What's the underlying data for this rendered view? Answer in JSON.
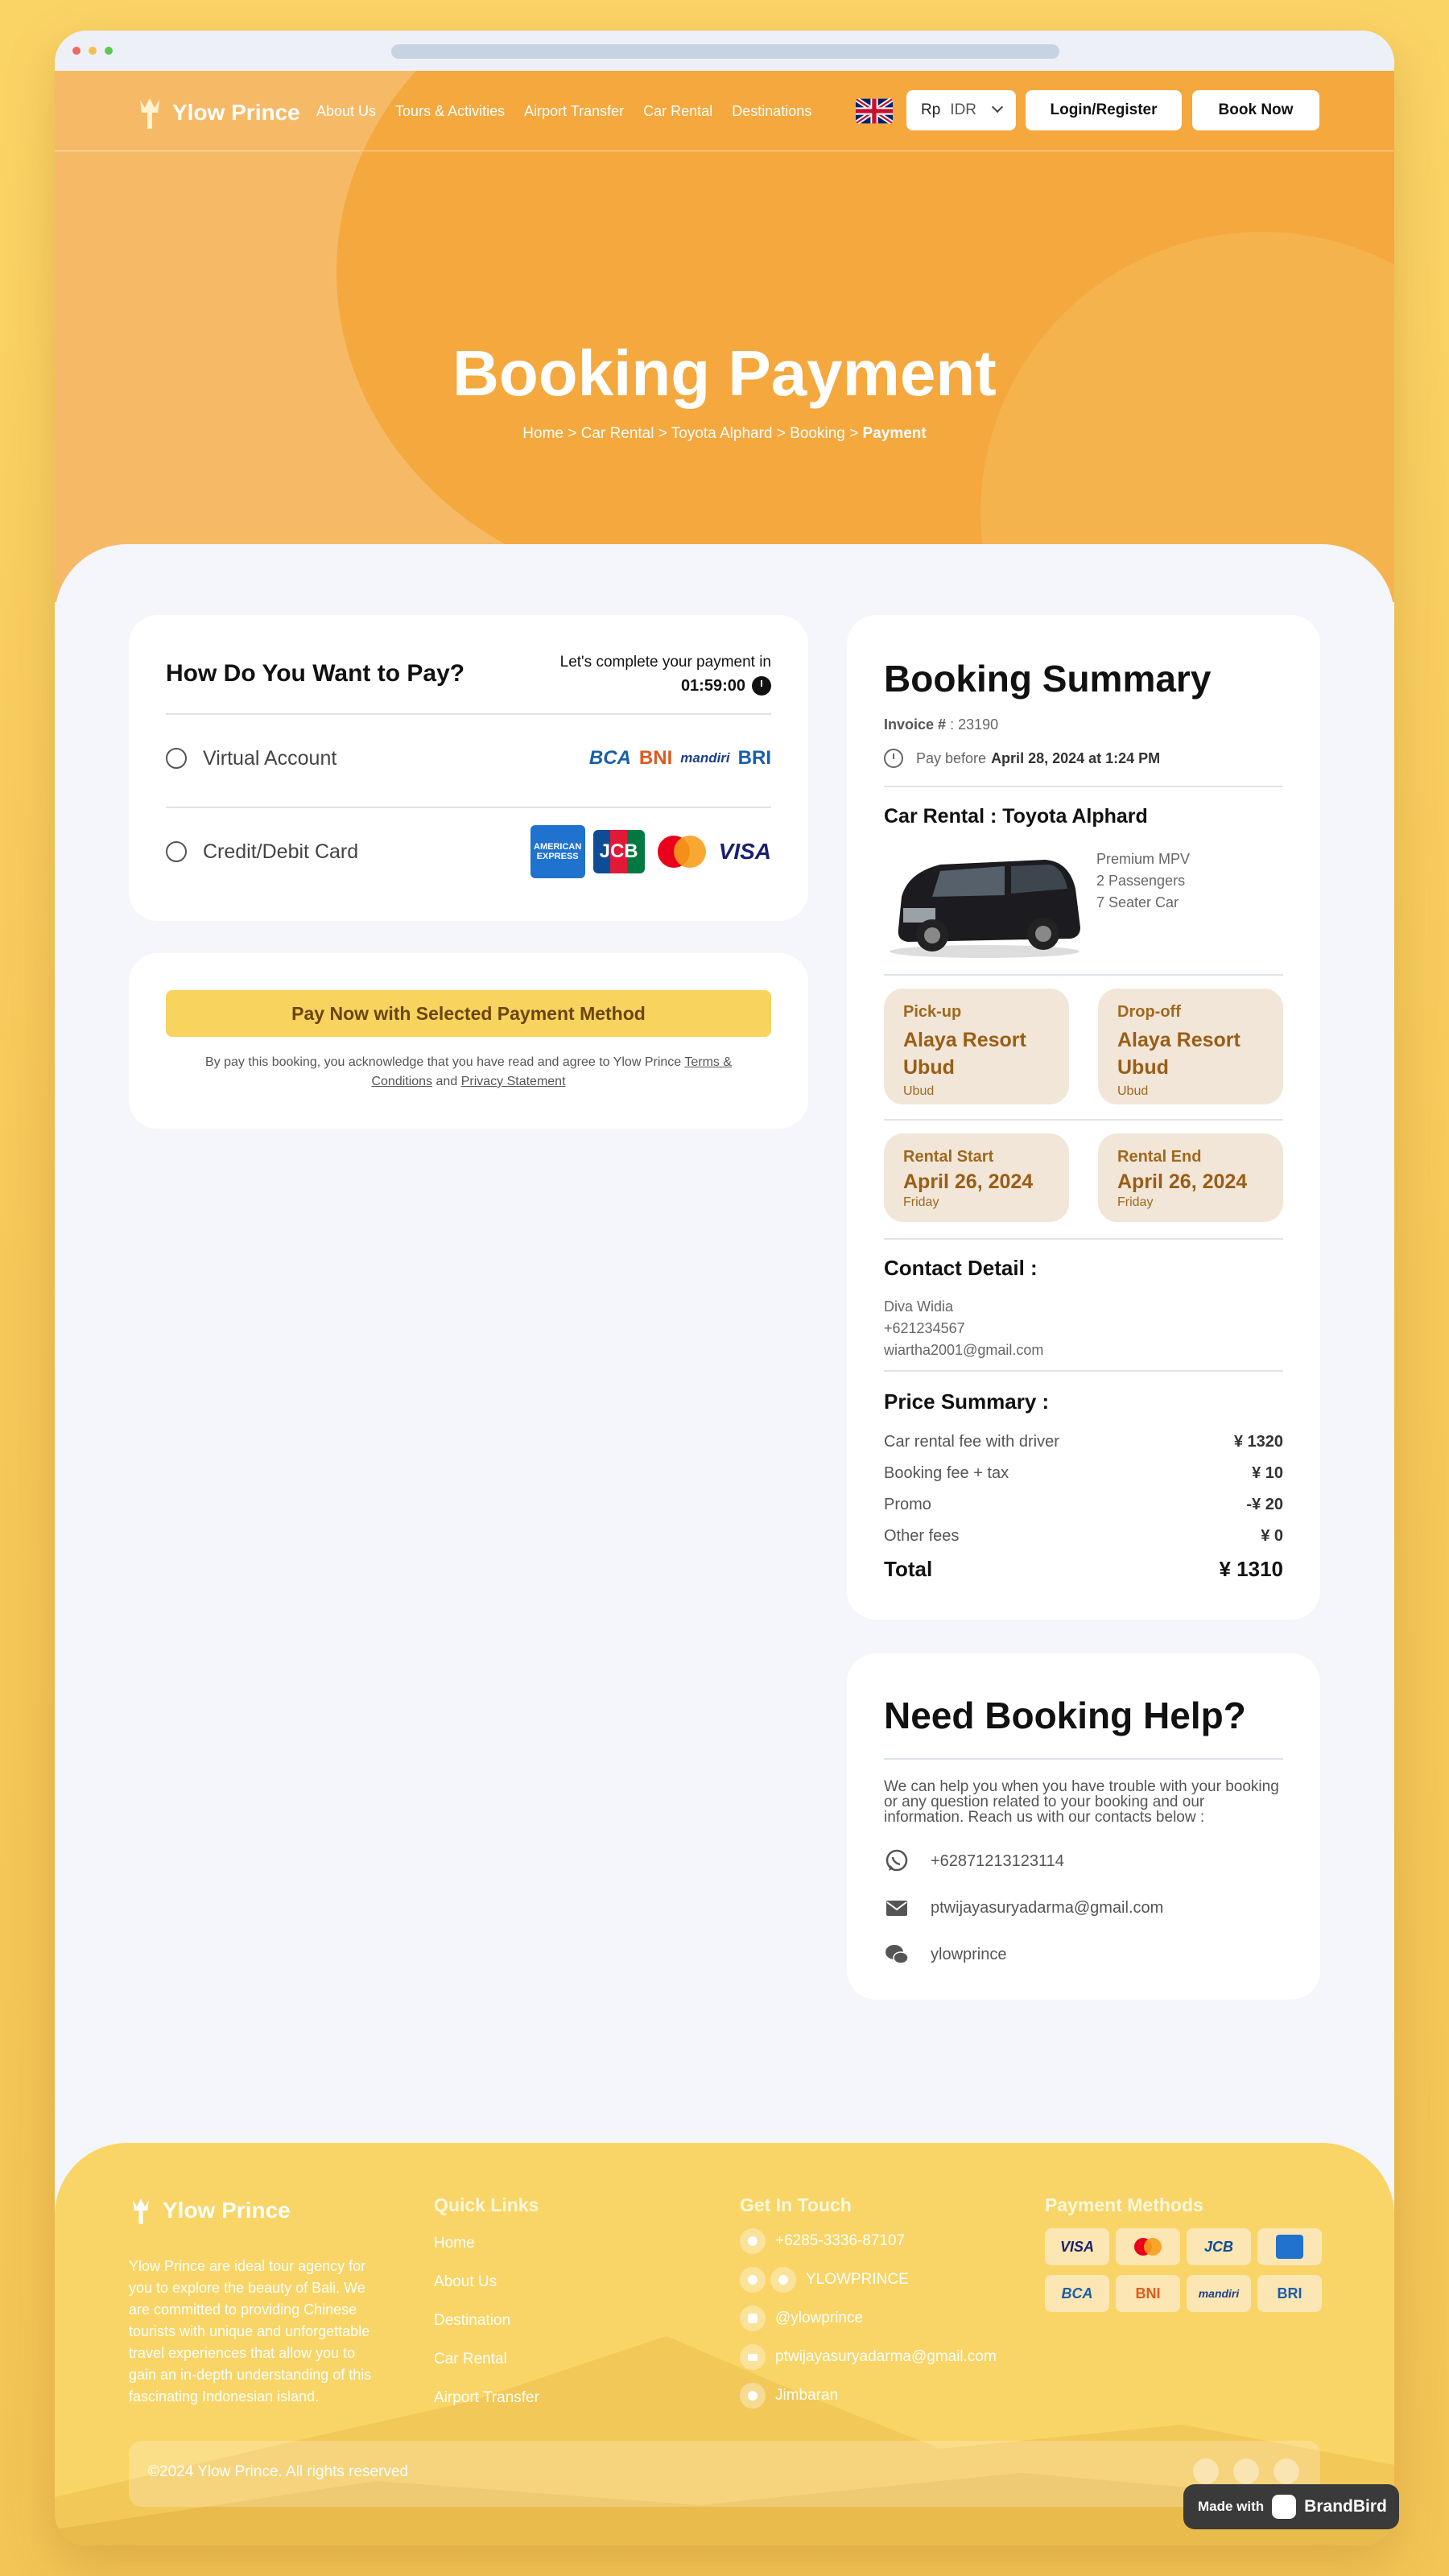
{
  "header": {
    "brand": "Ylow Prince",
    "nav": [
      "About Us",
      "Tours & Activities",
      "Airport Transfer",
      "Car Rental",
      "Destinations"
    ],
    "currency_symbol": "Rp",
    "currency_code": "IDR",
    "login_label": "Login/Register",
    "book_label": "Book Now"
  },
  "hero": {
    "title": "Booking Payment",
    "breadcrumbs": [
      "Home",
      "Car Rental",
      "Toyota Alphard",
      "Booking"
    ],
    "breadcrumb_current": "Payment",
    "separator": ">"
  },
  "payment": {
    "title": "How Do You Want to Pay?",
    "complete_text": "Let's complete your payment in",
    "timer": "01:59:00",
    "options": [
      {
        "label": "Virtual Account",
        "logos": [
          "BCA",
          "BNI",
          "mandiri",
          "BRI"
        ]
      },
      {
        "label": "Credit/Debit Card",
        "logos": [
          "AMERICAN EXPRESS",
          "JCB",
          "mastercard",
          "VISA"
        ]
      }
    ],
    "pay_button": "Pay Now with Selected Payment Method",
    "agree_pre": "By pay this booking, you acknowledge that you have read and agree to Ylow Prince",
    "terms": "Terms & Conditions",
    "and": "and",
    "privacy": "Privacy Statement"
  },
  "summary": {
    "title": "Booking Summary",
    "invoice_label": "Invoice #",
    "invoice_value": ": 23190",
    "pay_before_label": "Pay before",
    "pay_before_value": "April 28, 2024 at 1:24 PM",
    "car_title": "Car Rental : Toyota Alphard",
    "car_specs": [
      "Premium MPV",
      "2 Passengers",
      "7 Seater Car"
    ],
    "pickup": {
      "label": "Pick-up",
      "value": "Alaya Resort Ubud",
      "sub": "Ubud"
    },
    "dropoff": {
      "label": "Drop-off",
      "value": "Alaya Resort Ubud",
      "sub": "Ubud"
    },
    "rental_start": {
      "label": "Rental Start",
      "value": "April 26, 2024",
      "sub": "Friday"
    },
    "rental_end": {
      "label": "Rental End",
      "value": "April 26, 2024",
      "sub": "Friday"
    },
    "contact_title": "Contact Detail :",
    "contact": [
      "Diva Widia",
      "+621234567",
      "wiartha2001@gmail.com"
    ],
    "price_title": "Price Summary :",
    "prices": [
      {
        "label": "Car rental fee with driver",
        "amount": "¥ 1320"
      },
      {
        "label": "Booking fee + tax",
        "amount": "¥ 10"
      },
      {
        "label": "Promo",
        "amount": "-¥ 20"
      },
      {
        "label": "Other fees",
        "amount": "¥ 0"
      }
    ],
    "total_label": "Total",
    "total_amount": "¥ 1310"
  },
  "help": {
    "title": "Need Booking Help?",
    "desc": "We can help you when you have trouble with your booking or any question related to your booking and our information. Reach us with our contacts below :",
    "contacts": [
      {
        "icon": "whatsapp-icon",
        "text": "+62871213123114"
      },
      {
        "icon": "mail-icon",
        "text": "ptwijayasuryadarma@gmail.com"
      },
      {
        "icon": "wechat-icon",
        "text": "ylowprince"
      }
    ]
  },
  "footer": {
    "brand": "Ylow Prince",
    "desc": "Ylow Prince are ideal tour agency for you to explore the beauty of Bali. We are committed to providing Chinese tourists with unique and unforgettable travel experiences that allow you to gain an in-depth understanding of this fascinating Indonesian island.",
    "quick_links_title": "Quick Links",
    "quick_links": [
      "Home",
      "About Us",
      "Destination",
      "Car Rental",
      "Airport Transfer"
    ],
    "touch_title": "Get In Touch",
    "touch": [
      "+6285-3336-87107",
      "YLOWPRINCE",
      "@ylowprince",
      "ptwijayasuryadarma@gmail.com",
      "Jimbaran"
    ],
    "payment_title": "Payment Methods",
    "payment_methods": [
      "VISA",
      "mastercard",
      "JCB",
      "AMEX",
      "BCA",
      "BNI",
      "mandiri",
      "BRI"
    ],
    "copyright": "©2024 Ylow Prince. All rights reserved"
  },
  "badge": {
    "made": "Made with",
    "name": "BrandBird"
  },
  "colors": {
    "accent": "#f4a83e",
    "button_yellow": "#f8d35e",
    "tile_bg": "#f1e6d8",
    "tile_text": "#9a5d16"
  }
}
